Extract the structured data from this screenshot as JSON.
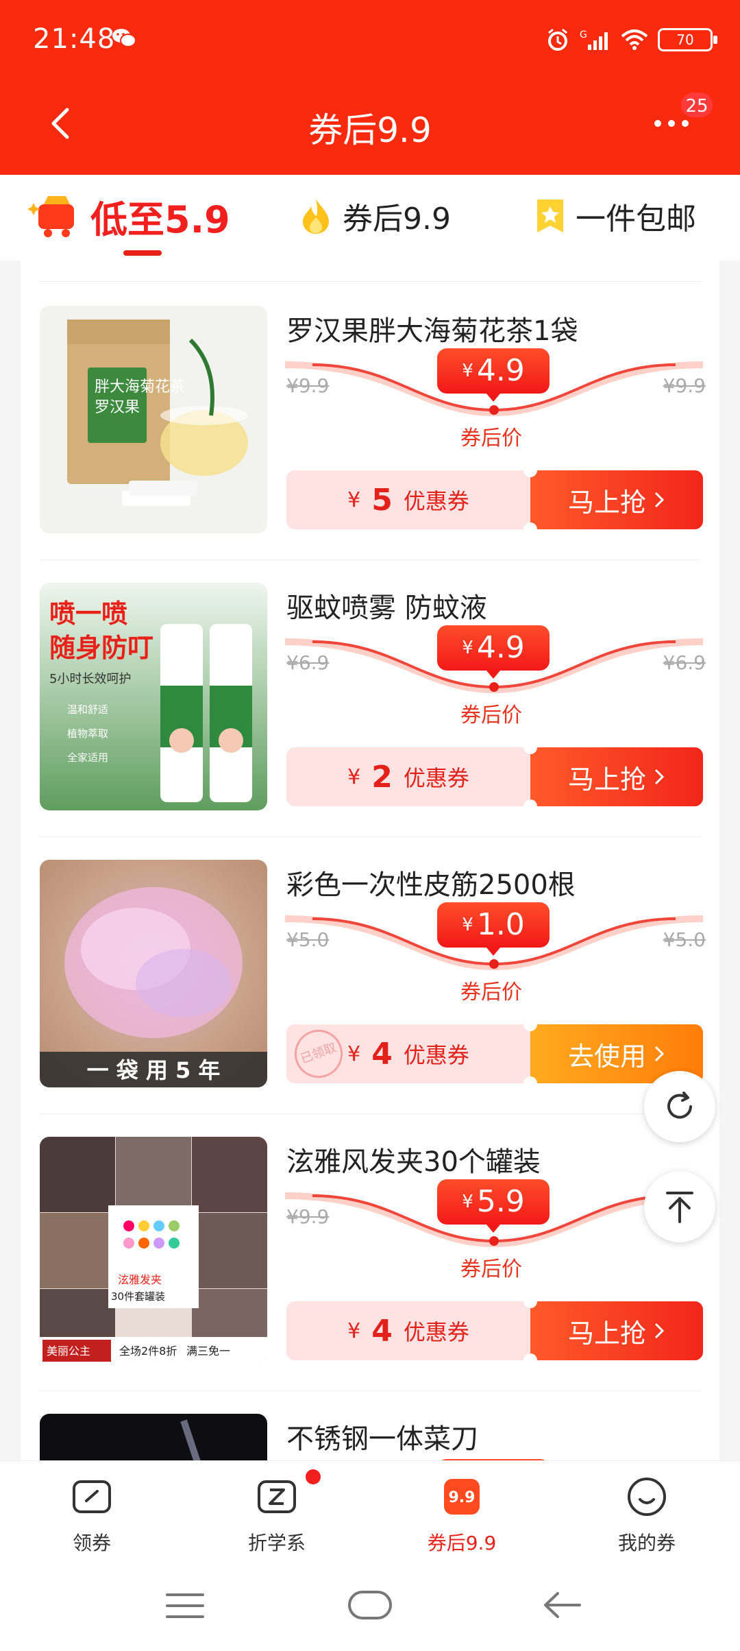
{
  "status": {
    "time": "21:48",
    "battery": "70"
  },
  "header": {
    "title": "券后9.9",
    "more_badge": "25"
  },
  "tabs": [
    {
      "label": "低至5.9",
      "active": true,
      "icon": "cart-sparkle-icon"
    },
    {
      "label": "券后9.9",
      "active": false,
      "icon": "flame-icon"
    },
    {
      "label": "一件包邮",
      "active": false,
      "icon": "star-ribbon-icon"
    }
  ],
  "items": [
    {
      "name": "罗汉果胖大海菊花茶1袋",
      "price_yen": "¥",
      "price": "4.9",
      "orig": "¥9.9",
      "after_label": "券后价",
      "coupon_yen": "¥",
      "coupon_amount": "5",
      "coupon_text": "优惠券",
      "action": "马上抢",
      "thumb_text": [
        "胖大海菊花茶",
        "罗汉果"
      ]
    },
    {
      "name": "驱蚊喷雾 防蚊液",
      "price_yen": "¥",
      "price": "4.9",
      "orig": "¥6.9",
      "after_label": "券后价",
      "coupon_yen": "¥",
      "coupon_amount": "2",
      "coupon_text": "优惠券",
      "action": "马上抢",
      "thumb_text": [
        "喷一喷",
        "随身防叮",
        "5小时长效呵护",
        "温和舒适",
        "植物萃取",
        "全家适用"
      ]
    },
    {
      "name": "彩色一次性皮筋2500根",
      "price_yen": "¥",
      "price": "1.0",
      "orig": "¥5.0",
      "after_label": "券后价",
      "coupon_yen": "¥",
      "coupon_amount": "4",
      "coupon_text": "优惠券",
      "action": "去使用",
      "stamp": "已领取",
      "thumb_text": [
        "一 袋 用 5 年"
      ]
    },
    {
      "name": "泫雅风发夹30个罐装",
      "price_yen": "¥",
      "price": "5.9",
      "orig": "¥9.9",
      "after_label": "券后价",
      "coupon_yen": "¥",
      "coupon_amount": "4",
      "coupon_text": "优惠券",
      "action": "马上抢",
      "thumb_text": [
        "泫雅发夹",
        "30件套罐装",
        "美丽公主",
        "全场2件8折",
        "满三免一"
      ]
    },
    {
      "name": "不锈钢一体菜刀"
    }
  ],
  "bottom_nav": [
    {
      "label": "领券",
      "icon": "coupon-ticket-icon"
    },
    {
      "label": "折学系",
      "icon": "z-ticket-icon"
    },
    {
      "label": "券后9.9",
      "icon": "nine-nine-badge-icon",
      "badge_text": "9.9"
    },
    {
      "label": "我的券",
      "icon": "smile-face-icon"
    }
  ],
  "colors": {
    "primary_red": "#fa2a0f",
    "accent_red": "#e8221a",
    "orange": "#ff8a12"
  }
}
